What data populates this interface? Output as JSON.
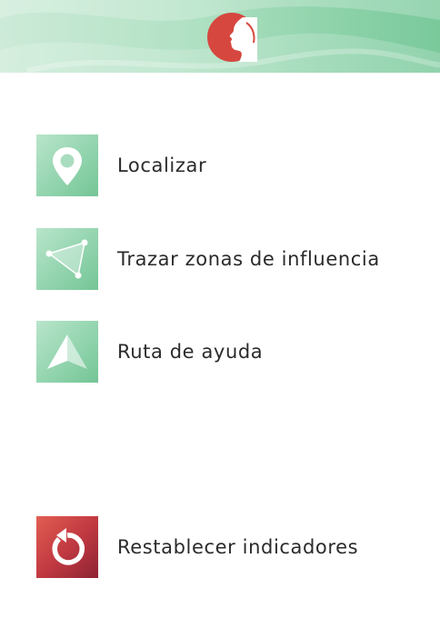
{
  "header": {
    "logo_icon": "woman-profile-logo",
    "colors": {
      "gradient_light": "#cdebd8",
      "gradient_dark": "#79c99b",
      "logo": "#d6473f"
    }
  },
  "menu": {
    "items": [
      {
        "label": "Localizar",
        "icon": "location-pin-icon",
        "color": "#8fd3ab"
      },
      {
        "label": "Trazar zonas de influencia",
        "icon": "polygon-area-icon",
        "color": "#8fd3ab"
      },
      {
        "label": "Ruta de ayuda",
        "icon": "navigation-arrow-icon",
        "color": "#8fd3ab"
      },
      {
        "label": "Restablecer indicadores",
        "icon": "reset-icon",
        "color": "#c23a42"
      }
    ]
  }
}
